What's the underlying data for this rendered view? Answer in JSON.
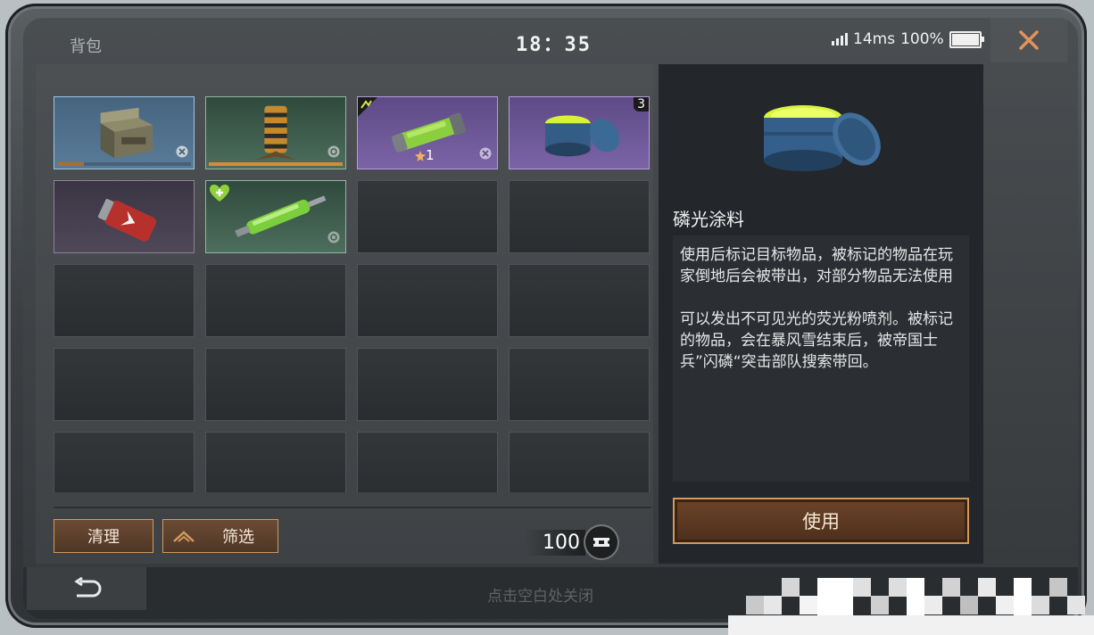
{
  "header": {
    "title": "背包",
    "time": "18：35",
    "ping": "14ms",
    "battery": "100%"
  },
  "inventory": {
    "slots": [
      {
        "name": "ammo-crate",
        "rarity": "blue",
        "progress": 0.2
      },
      {
        "name": "battery-coil",
        "rarity": "green",
        "progress": 1.0
      },
      {
        "name": "green-canister",
        "rarity": "purple",
        "quantity": "1"
      },
      {
        "name": "phosphor-paint-jar",
        "rarity": "purple",
        "count": "3"
      },
      {
        "name": "red-grenade",
        "rarity": "dark"
      },
      {
        "name": "green-syringe",
        "rarity": "green"
      }
    ],
    "clean_label": "清理",
    "filter_label": "筛选",
    "currency_amount": "100"
  },
  "detail": {
    "item_name": "磷光涂料",
    "description_1": "使用后标记目标物品，被标记的物品在玩家倒地后会被带出，对部分物品无法使用",
    "description_2": "可以发出不可见光的荧光粉喷剂。被标记的物品，会在暴风雪结束后，被帝国士兵”闪磷“突击部队搜索带回。",
    "use_label": "使用"
  },
  "footer": {
    "hint": "点击空白处关闭"
  },
  "colors": {
    "accent": "#d29a5c",
    "blue_rarity": "#9cc7e6",
    "green_rarity": "#8fb7a1",
    "purple_rarity": "#b59be0"
  }
}
